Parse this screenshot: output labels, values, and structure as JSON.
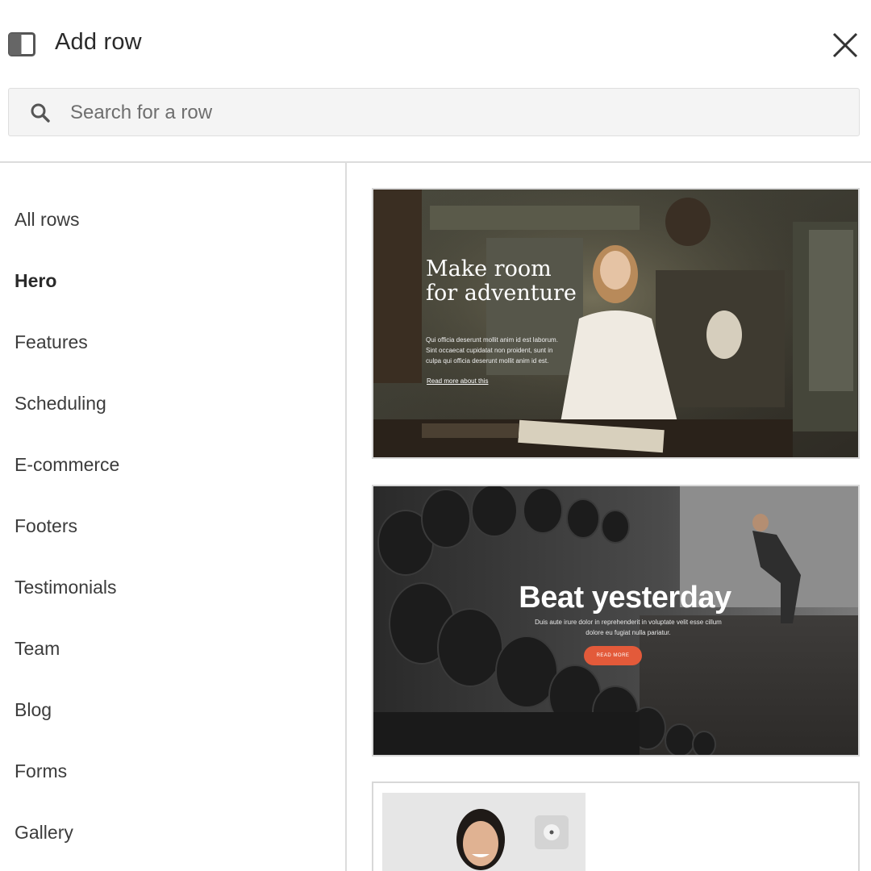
{
  "header": {
    "title": "Add row",
    "panel_icon": "sidebar-panel-icon",
    "close_icon": "close-icon"
  },
  "search": {
    "placeholder": "Search for a row",
    "value": "",
    "icon": "search-icon"
  },
  "sidebar": {
    "active": "Hero",
    "items": [
      {
        "label": "All rows"
      },
      {
        "label": "Hero"
      },
      {
        "label": "Features"
      },
      {
        "label": "Scheduling"
      },
      {
        "label": "E-commerce"
      },
      {
        "label": "Footers"
      },
      {
        "label": "Testimonials"
      },
      {
        "label": "Team"
      },
      {
        "label": "Blog"
      },
      {
        "label": "Forms"
      },
      {
        "label": "Gallery"
      }
    ]
  },
  "rows": [
    {
      "heading": "Make room for adventure",
      "body": "Qui officia deserunt mollit anim id est laborum. Sint occaecat cupidatat non proident, sunt in culpa qui officia deserunt mollit anim id est.",
      "link": "Read more about this"
    },
    {
      "heading": "Beat yesterday",
      "body": "Duis aute irure dolor in reprehenderit in voluptate velit esse cillum dolore eu fugiat nulla pariatur.",
      "button": "READ MORE",
      "button_color": "#e35a3a"
    },
    {
      "heading": "",
      "body": ""
    }
  ],
  "colors": {
    "divider": "#dcdcdc",
    "search_bg": "#f4f4f4"
  }
}
